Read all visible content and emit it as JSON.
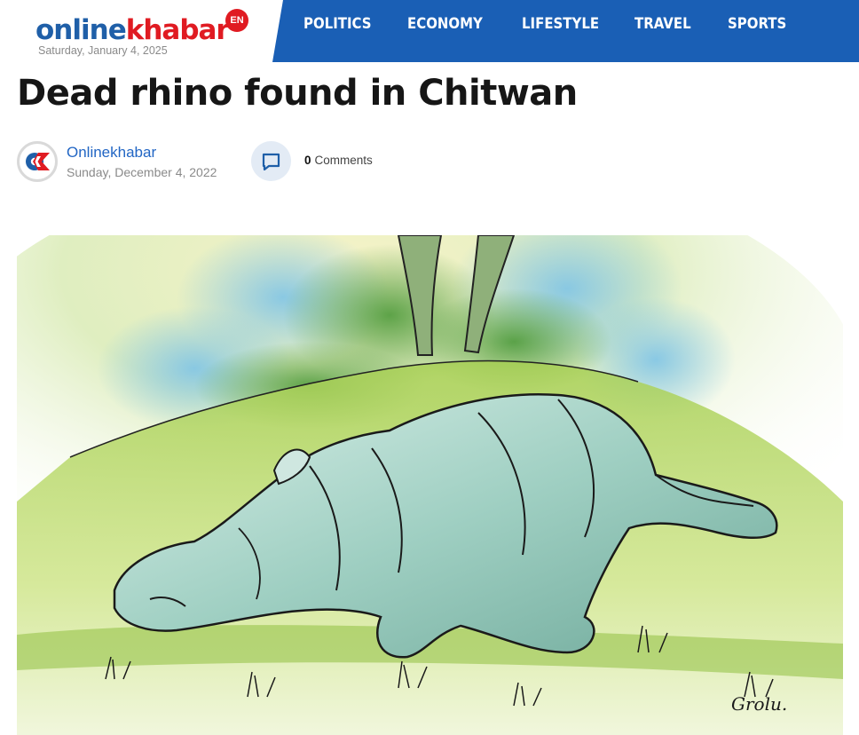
{
  "site": {
    "logo_part1": "online",
    "logo_part2": "khabar",
    "edition_badge": "EN",
    "date": "Saturday, January 4, 2025"
  },
  "nav": {
    "items": [
      "POLITICS",
      "ECONOMY",
      "LIFESTYLE",
      "TRAVEL",
      "SPORTS"
    ]
  },
  "article": {
    "title": "Dead rhino found in Chitwan",
    "author": "Onlinekhabar",
    "date": "Sunday, December 4, 2022",
    "comments_count": "0",
    "comments_label": "Comments"
  },
  "hero": {
    "signature": "Grolu."
  },
  "colors": {
    "brand_blue": "#1f5fa8",
    "brand_red": "#e01b22",
    "nav_bg": "#1a5fb5",
    "link_blue": "#2266c4"
  },
  "icons": {
    "avatar": "ok-logo-icon",
    "comment": "comment-bubble-icon"
  }
}
